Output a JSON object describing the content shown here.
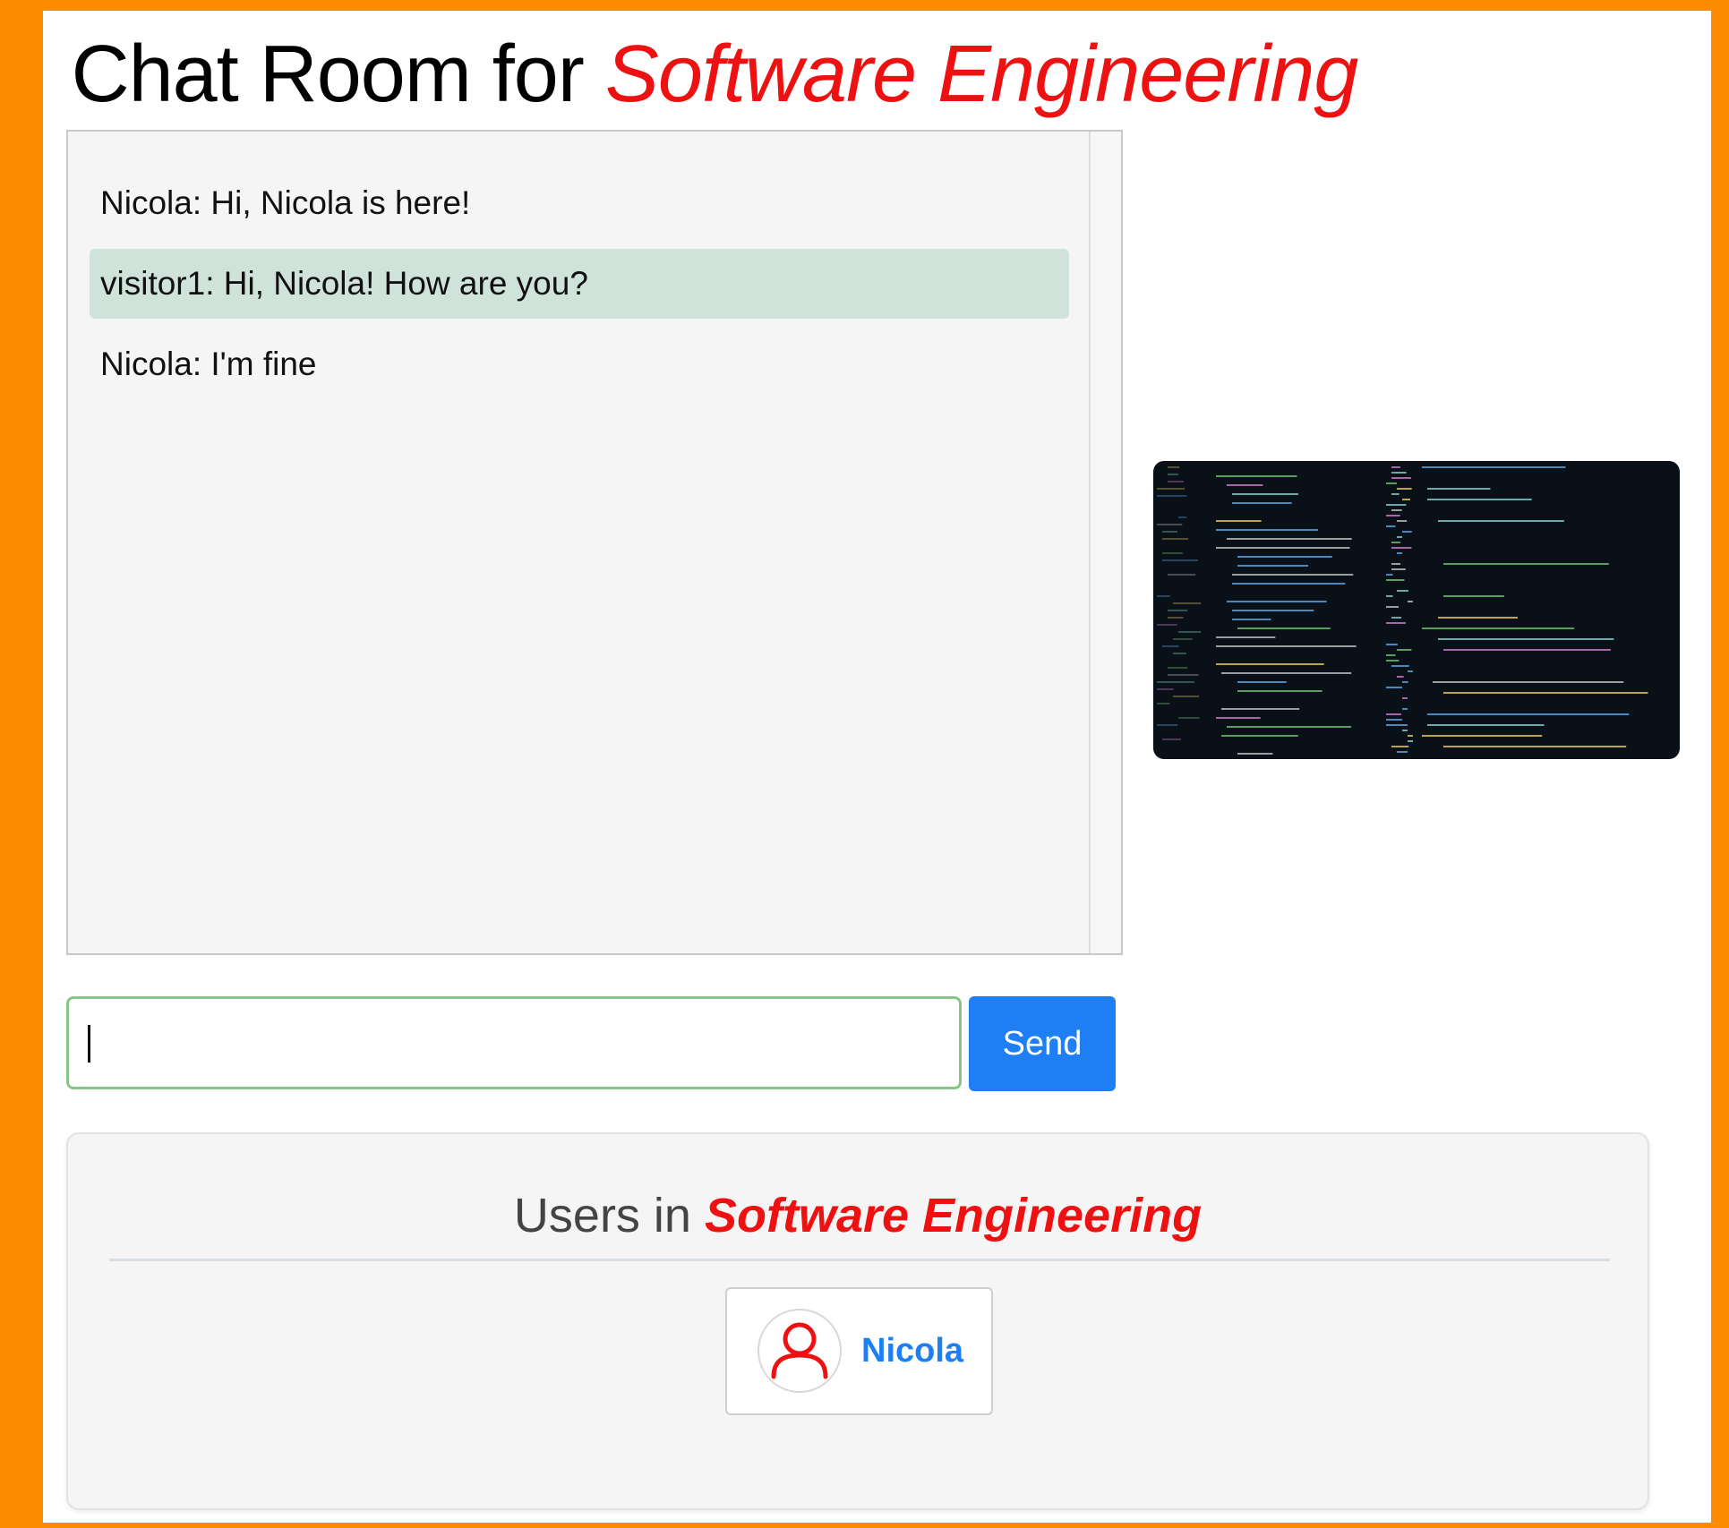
{
  "page": {
    "title_prefix": "Chat Room for ",
    "title_room": "Software Engineering"
  },
  "chat": {
    "messages": [
      {
        "text": "Nicola: Hi, Nicola is here!"
      },
      {
        "text": "visitor1: Hi, Nicola! How are you?"
      },
      {
        "text": "Nicola: I'm fine"
      }
    ]
  },
  "composer": {
    "value": "",
    "send_label": "Send"
  },
  "users": {
    "title_prefix": "Users in ",
    "title_room": "Software Engineering",
    "list": [
      {
        "name": "Nicola",
        "icon": "user-icon"
      }
    ]
  },
  "colors": {
    "background": "#ff8c00",
    "accent_red": "#ee1111",
    "primary_blue": "#1e7ef3",
    "highlight_message": "#cfe3da",
    "input_focus": "#88c588"
  }
}
